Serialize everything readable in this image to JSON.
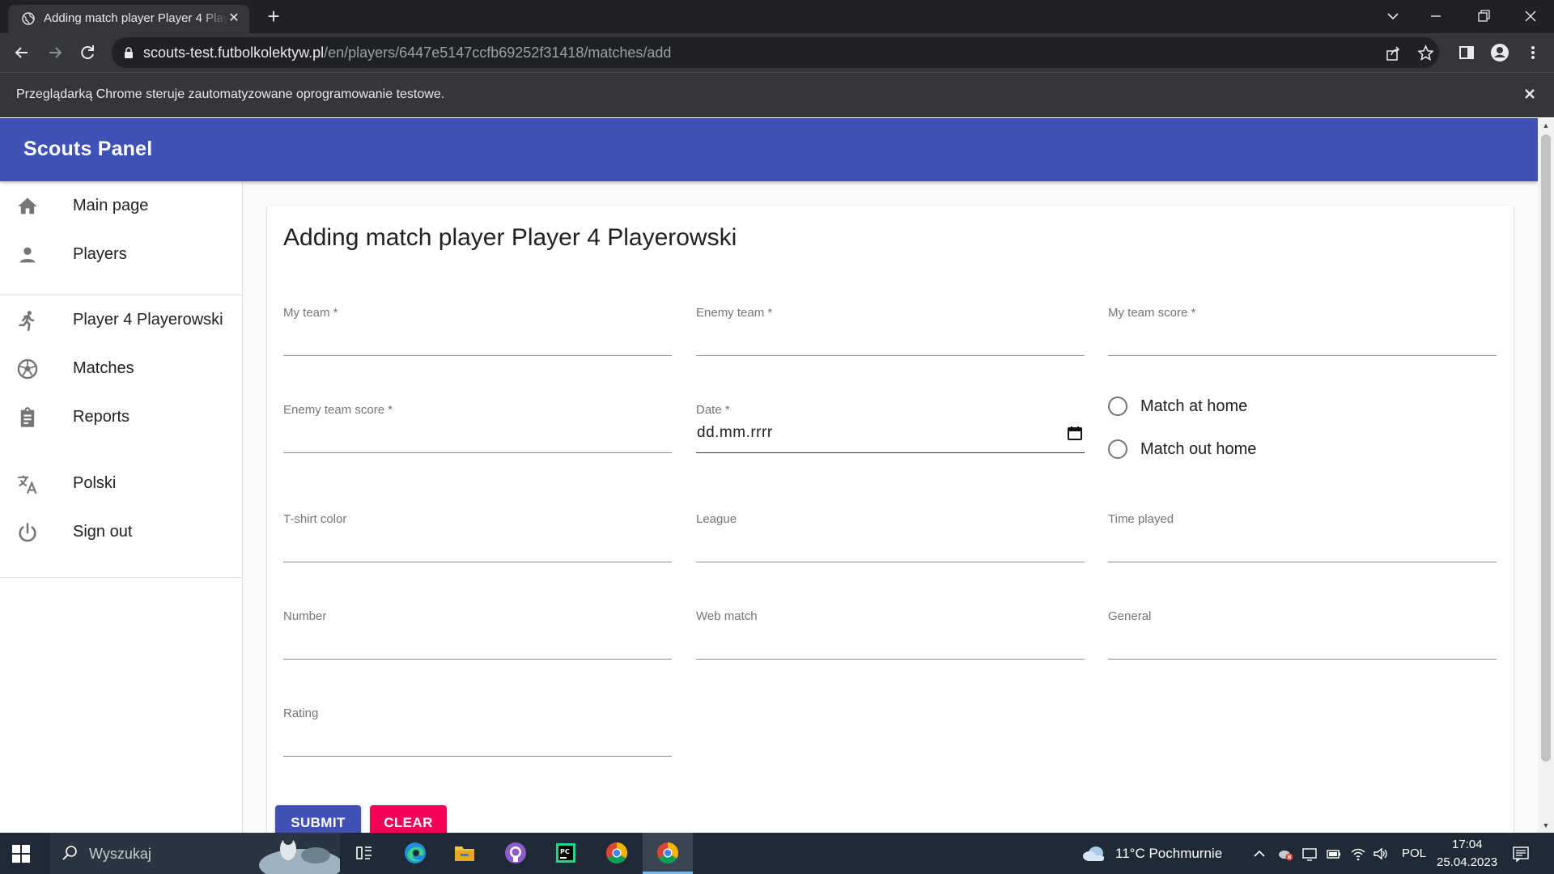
{
  "browser": {
    "tab_title": "Adding match player Player 4 Playerowski",
    "url_host": "scouts-test.futbolkolektyw.pl",
    "url_path": "/en/players/6447e5147ccfb69252f31418/matches/add",
    "infobar_text": "Przeglądarką Chrome steruje zautomatyzowane oprogramowanie testowe."
  },
  "app": {
    "title": "Scouts Panel",
    "accent_color": "#3f51b5",
    "secondary_color": "#f50057"
  },
  "sidebar": {
    "items": [
      {
        "label": "Main page",
        "icon": "home-icon"
      },
      {
        "label": "Players",
        "icon": "person-icon"
      },
      {
        "label": "Player 4 Playerowski",
        "icon": "running-icon"
      },
      {
        "label": "Matches",
        "icon": "soccer-ball-icon"
      },
      {
        "label": "Reports",
        "icon": "clipboard-icon"
      },
      {
        "label": "Polski",
        "icon": "translate-icon"
      },
      {
        "label": "Sign out",
        "icon": "power-icon"
      }
    ]
  },
  "form": {
    "title": "Adding match player Player 4 Playerowski",
    "fields": {
      "my_team": "My team *",
      "enemy_team": "Enemy team *",
      "my_team_score": "My team score *",
      "enemy_team_score": "Enemy team score *",
      "date": "Date *",
      "date_value": "dd.mm.rrrr",
      "tshirt_color": "T-shirt color",
      "league": "League",
      "time_played": "Time played",
      "number": "Number",
      "web_match": "Web match",
      "general": "General",
      "rating": "Rating"
    },
    "radios": {
      "home": "Match at home",
      "out": "Match out home"
    },
    "buttons": {
      "submit": "SUBMIT",
      "clear": "CLEAR"
    }
  },
  "taskbar": {
    "search_placeholder": "Wyszukaj",
    "weather": "11°C  Pochmurnie",
    "language": "POL",
    "time": "17:04",
    "date": "25.04.2023"
  }
}
